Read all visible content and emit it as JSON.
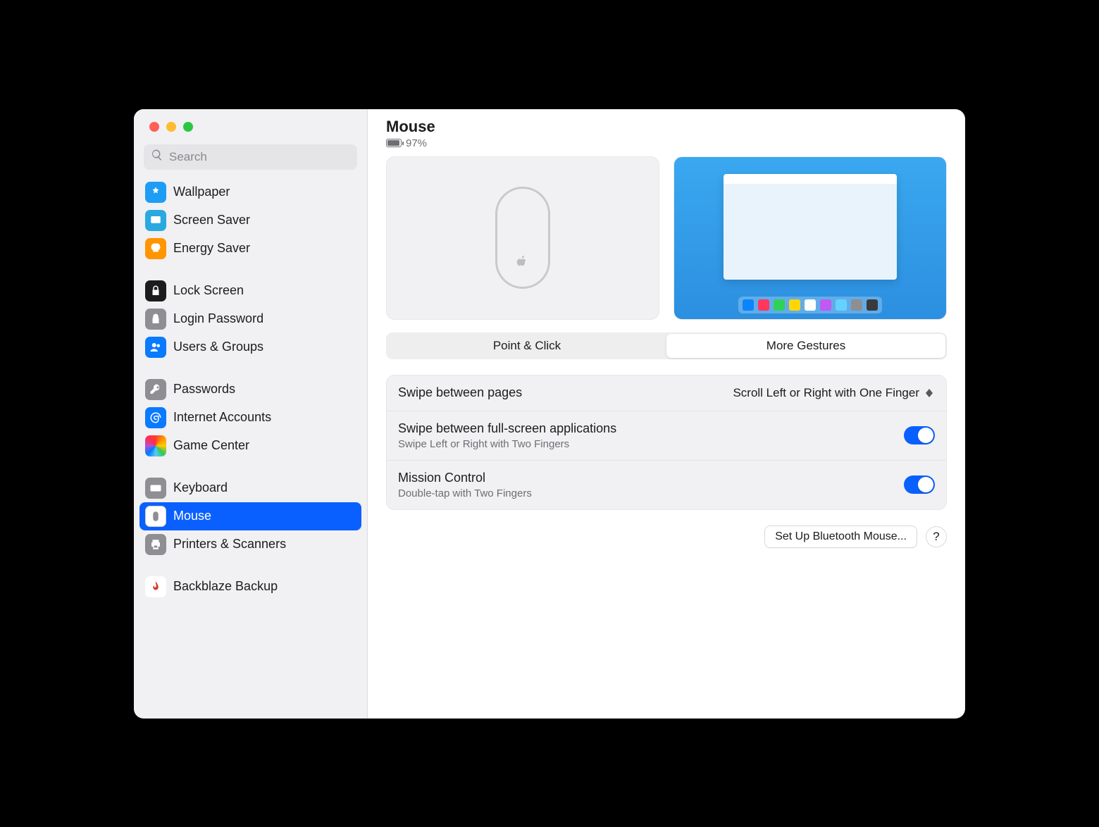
{
  "search": {
    "placeholder": "Search"
  },
  "header": {
    "title": "Mouse",
    "battery": "97%"
  },
  "sidebar": {
    "groups": [
      {
        "items": [
          {
            "label": "Wallpaper"
          },
          {
            "label": "Screen Saver"
          },
          {
            "label": "Energy Saver"
          }
        ]
      },
      {
        "items": [
          {
            "label": "Lock Screen"
          },
          {
            "label": "Login Password"
          },
          {
            "label": "Users & Groups"
          }
        ]
      },
      {
        "items": [
          {
            "label": "Passwords"
          },
          {
            "label": "Internet Accounts"
          },
          {
            "label": "Game Center"
          }
        ]
      },
      {
        "items": [
          {
            "label": "Keyboard"
          },
          {
            "label": "Mouse",
            "selected": true
          },
          {
            "label": "Printers & Scanners"
          }
        ]
      },
      {
        "items": [
          {
            "label": "Backblaze Backup"
          }
        ]
      }
    ]
  },
  "tabs": {
    "point_click": "Point & Click",
    "more_gestures": "More Gestures",
    "active": "more_gestures"
  },
  "rows": {
    "swipe_pages": {
      "title": "Swipe between pages",
      "value": "Scroll Left or Right with One Finger"
    },
    "swipe_apps": {
      "title": "Swipe between full-screen applications",
      "sub": "Swipe Left or Right with Two Fingers"
    },
    "mission": {
      "title": "Mission Control",
      "sub": "Double-tap with Two Fingers"
    }
  },
  "footer": {
    "setup": "Set Up Bluetooth Mouse...",
    "help": "?"
  },
  "dock_colors": [
    "#0a84ff",
    "#ff375f",
    "#30d158",
    "#ffd60a",
    "#ffffff",
    "#bf5af2",
    "#64d2ff",
    "#8e8e93",
    "#3a3a3c"
  ]
}
